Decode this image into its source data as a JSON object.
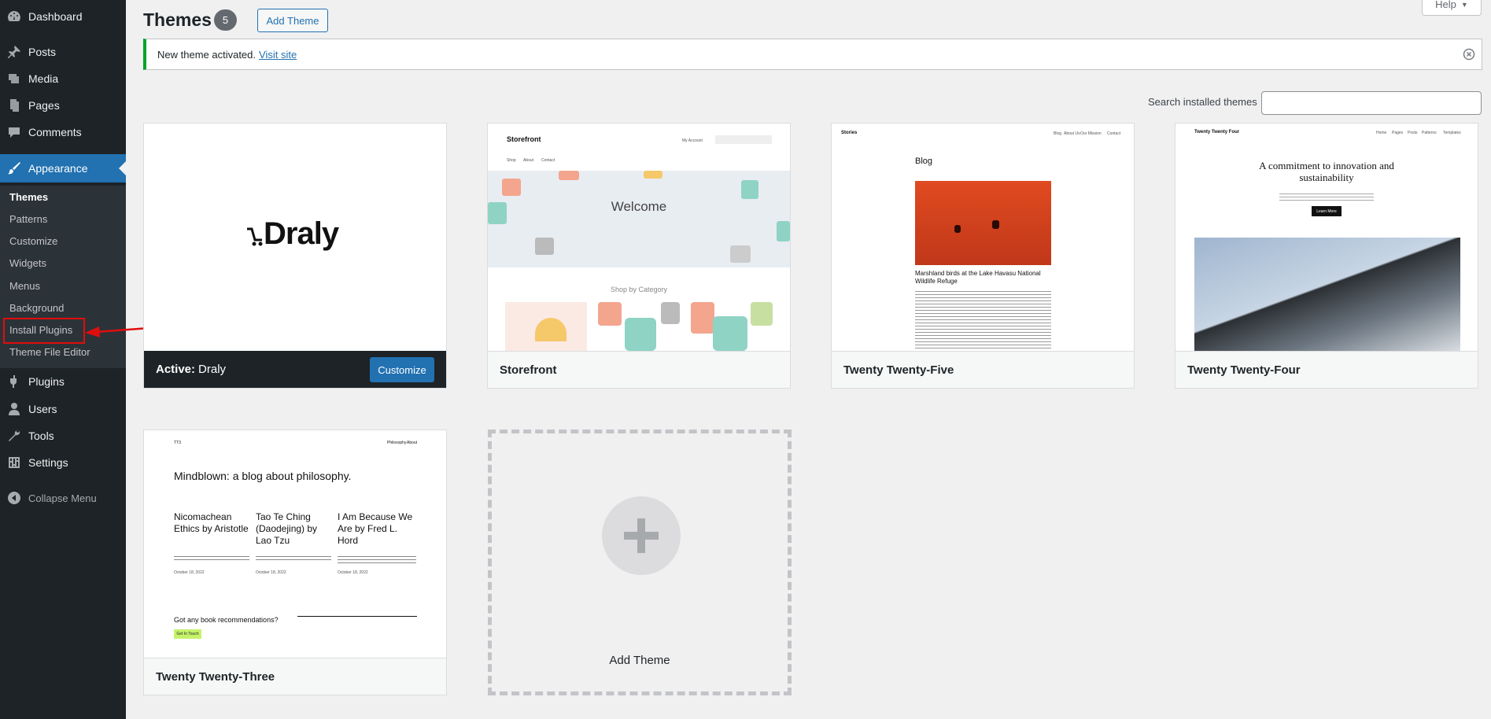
{
  "sidebar": {
    "items": [
      {
        "label": "Dashboard",
        "icon": "dashboard-icon"
      },
      {
        "label": "Posts",
        "icon": "pin-icon"
      },
      {
        "label": "Media",
        "icon": "media-icon"
      },
      {
        "label": "Pages",
        "icon": "pages-icon"
      },
      {
        "label": "Comments",
        "icon": "comments-icon"
      },
      {
        "label": "Appearance",
        "icon": "brush-icon"
      },
      {
        "label": "Plugins",
        "icon": "plugin-icon"
      },
      {
        "label": "Users",
        "icon": "user-icon"
      },
      {
        "label": "Tools",
        "icon": "wrench-icon"
      },
      {
        "label": "Settings",
        "icon": "settings-icon"
      }
    ],
    "submenu": [
      "Themes",
      "Patterns",
      "Customize",
      "Widgets",
      "Menus",
      "Background",
      "Install Plugins",
      "Theme File Editor"
    ],
    "collapse": "Collapse Menu"
  },
  "header": {
    "title": "Themes",
    "count": "5",
    "add_button": "Add Theme",
    "help": "Help"
  },
  "notice": {
    "text": "New theme activated.",
    "link": "Visit site"
  },
  "search": {
    "label": "Search installed themes",
    "value": ""
  },
  "themes": [
    {
      "name": "Draly",
      "active_label": "Active:",
      "customize": "Customize",
      "logo_text": "Draly"
    },
    {
      "name": "Storefront",
      "site_title": "Storefront",
      "welcome": "Welcome",
      "shop_by": "Shop by Category",
      "nav": [
        "Shop",
        "About",
        "Contact"
      ],
      "account": "My Account"
    },
    {
      "name": "Twenty Twenty-Five",
      "site_title": "Stories",
      "heading": "Blog",
      "nav": [
        "Blog",
        "About Us",
        "Our Mission",
        "Contact"
      ],
      "caption": "Marshland birds at the Lake Havasu National Wildlife Refuge"
    },
    {
      "name": "Twenty Twenty-Four",
      "site_title": "Twenty Twenty Four",
      "heading": "A commitment to innovation and sustainability",
      "nav": [
        "Home",
        "Pages",
        "Posts",
        "Patterns",
        "Templates"
      ],
      "cta": "Learn More"
    },
    {
      "name": "Twenty Twenty-Three",
      "site_title": "TT3",
      "heading": "Mindblown: a blog about philosophy.",
      "nav": [
        "Philosophy",
        "About"
      ],
      "posts": [
        "Nicomachean Ethics by Aristotle",
        "Tao Te Ching (Daodejing) by Lao Tzu",
        "I Am Because We Are by Fred L. Hord"
      ],
      "dates": [
        "October 18, 2022",
        "October 18, 2022",
        "October 18, 2022"
      ],
      "cta_heading": "Got any book recommendations?",
      "cta_button": "Get In Touch"
    }
  ],
  "add_theme_card": "Add Theme",
  "colors": {
    "sidebar": "#1d2327",
    "accent": "#2271b1",
    "success": "#00a32a",
    "highlight": "#e00d0d"
  }
}
